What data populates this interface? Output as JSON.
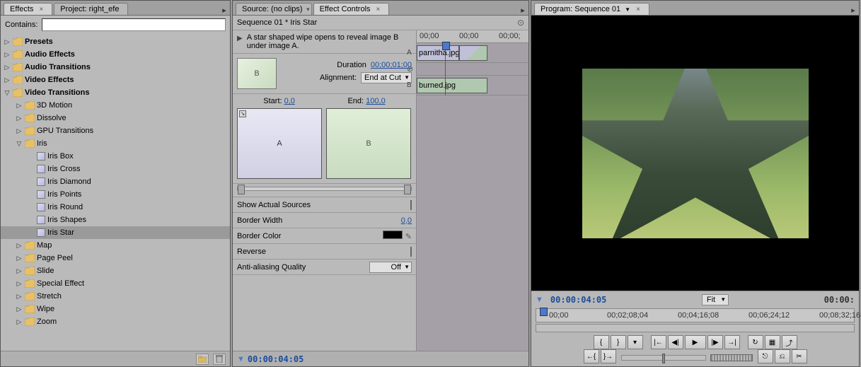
{
  "left": {
    "tabs": [
      {
        "label": "Effects",
        "active": true,
        "closable": true
      },
      {
        "label": "Project: right_efe",
        "active": false,
        "closable": false
      }
    ],
    "contains_label": "Contains:",
    "contains_value": "",
    "tree": [
      {
        "level": 0,
        "type": "folder",
        "label": "Presets",
        "bold": true,
        "expand": "▷"
      },
      {
        "level": 0,
        "type": "folder",
        "label": "Audio Effects",
        "bold": true,
        "expand": "▷"
      },
      {
        "level": 0,
        "type": "folder",
        "label": "Audio Transitions",
        "bold": true,
        "expand": "▷"
      },
      {
        "level": 0,
        "type": "folder",
        "label": "Video Effects",
        "bold": true,
        "expand": "▷"
      },
      {
        "level": 0,
        "type": "folder",
        "label": "Video Transitions",
        "bold": true,
        "expand": "▽"
      },
      {
        "level": 1,
        "type": "folder",
        "label": "3D Motion",
        "expand": "▷"
      },
      {
        "level": 1,
        "type": "folder",
        "label": "Dissolve",
        "expand": "▷"
      },
      {
        "level": 1,
        "type": "folder",
        "label": "GPU Transitions",
        "expand": "▷"
      },
      {
        "level": 1,
        "type": "folder",
        "label": "Iris",
        "expand": "▽"
      },
      {
        "level": 2,
        "type": "effect",
        "label": "Iris Box"
      },
      {
        "level": 2,
        "type": "effect",
        "label": "Iris Cross"
      },
      {
        "level": 2,
        "type": "effect",
        "label": "Iris Diamond"
      },
      {
        "level": 2,
        "type": "effect",
        "label": "Iris Points"
      },
      {
        "level": 2,
        "type": "effect",
        "label": "Iris Round"
      },
      {
        "level": 2,
        "type": "effect",
        "label": "Iris Shapes"
      },
      {
        "level": 2,
        "type": "effect",
        "label": "Iris Star",
        "selected": true
      },
      {
        "level": 1,
        "type": "folder",
        "label": "Map",
        "expand": "▷"
      },
      {
        "level": 1,
        "type": "folder",
        "label": "Page Peel",
        "expand": "▷"
      },
      {
        "level": 1,
        "type": "folder",
        "label": "Slide",
        "expand": "▷"
      },
      {
        "level": 1,
        "type": "folder",
        "label": "Special Effect",
        "expand": "▷"
      },
      {
        "level": 1,
        "type": "folder",
        "label": "Stretch",
        "expand": "▷"
      },
      {
        "level": 1,
        "type": "folder",
        "label": "Wipe",
        "expand": "▷"
      },
      {
        "level": 1,
        "type": "folder",
        "label": "Zoom",
        "expand": "▷"
      }
    ]
  },
  "mid": {
    "tabs": [
      {
        "label": "Source: (no clips)",
        "active": false
      },
      {
        "label": "Effect Controls",
        "active": true,
        "closable": true
      }
    ],
    "breadcrumb": "Sequence 01 * Iris Star",
    "description": "A star shaped wipe opens to reveal image B under image A.",
    "thumb_letter": "B",
    "duration_label": "Duration",
    "duration_value": "00;00;01;00",
    "alignment_label": "Alignment:",
    "alignment_value": "End at Cut",
    "start_label": "Start:",
    "start_value": "0,0",
    "end_label": "End:",
    "end_value": "100,0",
    "preview_a": "A",
    "preview_b": "B",
    "props": [
      {
        "label": "Show Actual Sources",
        "type": "check"
      },
      {
        "label": "Border Width",
        "type": "link",
        "value": "0,0"
      },
      {
        "label": "Border Color",
        "type": "color",
        "value": "#000000"
      },
      {
        "label": "Reverse",
        "type": "check"
      },
      {
        "label": "Anti-aliasing Quality",
        "type": "select",
        "value": "Off"
      }
    ],
    "timecode": "00:00:04:05",
    "ruler": [
      "00;00",
      "00;00",
      "00;00;"
    ],
    "track_a_label": "A",
    "track_b_label": "B",
    "clip_a": "parnitha.jpg",
    "clip_b": "burned.jpg"
  },
  "right": {
    "tabs": [
      {
        "label": "Program: Sequence 01",
        "active": true
      }
    ],
    "timecode_left": "00:00:04:05",
    "timecode_right": "00:00:",
    "fit_label": "Fit",
    "ruler": [
      "00;00",
      "00;02;08;04",
      "00;04;16;08",
      "00;06;24;12",
      "00;08;32;16"
    ]
  }
}
